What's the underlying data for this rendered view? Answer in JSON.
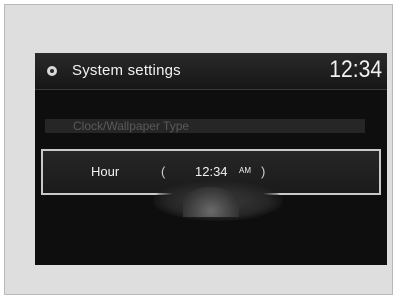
{
  "header": {
    "title": "System settings",
    "clock": "12:34",
    "icon": "gear-icon"
  },
  "menu": {
    "dim_item": "Clock/Wallpaper Type",
    "selected_item": {
      "label": "Hour",
      "value": "12:34",
      "period": "AM",
      "left_arrow": "(",
      "right_arrow": ")"
    }
  }
}
